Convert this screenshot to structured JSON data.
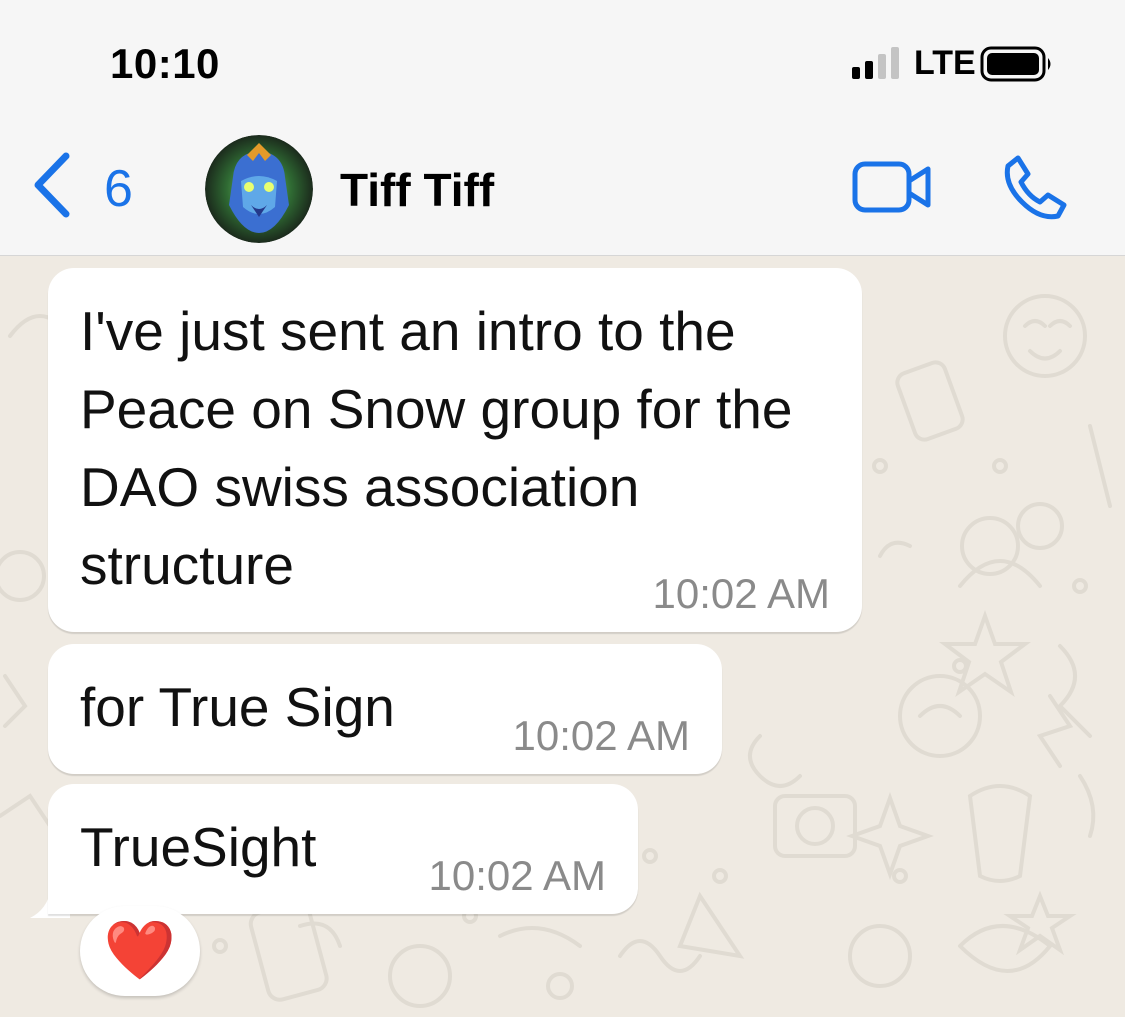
{
  "status_bar": {
    "time": "10:10",
    "network": "LTE",
    "icons": [
      "signal-icon",
      "battery-icon"
    ]
  },
  "header": {
    "back_count": "6",
    "contact_name": "Tiff Tiff",
    "icons": [
      "back-chevron-icon",
      "video-call-icon",
      "phone-icon"
    ],
    "accent_color": "#1a73e8"
  },
  "messages": [
    {
      "text": "I've just sent an intro to the Peace on Snow group for the DAO swiss association structure",
      "time": "10:02 AM"
    },
    {
      "text": "for True Sign",
      "time": "10:02 AM"
    },
    {
      "text": "TrueSight",
      "time": "10:02 AM"
    }
  ],
  "reaction": {
    "emoji": "❤️",
    "icon": "heart-reaction-icon"
  },
  "colors": {
    "chat_background": "#efeae2",
    "bubble": "#ffffff",
    "timestamp": "#8a8a8a"
  }
}
